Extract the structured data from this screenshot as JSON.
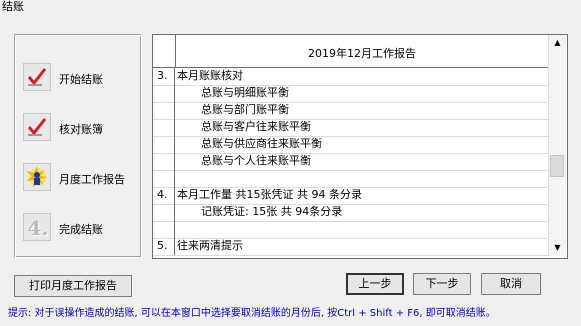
{
  "window": {
    "title": "结账"
  },
  "steps": [
    {
      "label": "开始结账",
      "icon": "check-mark-icon"
    },
    {
      "label": "核对账簿",
      "icon": "check-mark-icon"
    },
    {
      "label": "月度工作报告",
      "icon": "sparkle-person-icon"
    },
    {
      "label": "完成结账",
      "icon": "number-4-icon",
      "icon_text": "4."
    }
  ],
  "report": {
    "header": "2019年12月工作报告",
    "rows": [
      {
        "no": "3.",
        "text": "本月账账核对",
        "indent": false
      },
      {
        "no": "",
        "text": "总账与明细账平衡",
        "indent": true
      },
      {
        "no": "",
        "text": "总账与部门账平衡",
        "indent": true
      },
      {
        "no": "",
        "text": "总账与客户往来账平衡",
        "indent": true
      },
      {
        "no": "",
        "text": "总账与供应商往来账平衡",
        "indent": true
      },
      {
        "no": "",
        "text": "总账与个人往来账平衡",
        "indent": true
      },
      {
        "no": "",
        "text": "",
        "indent": false
      },
      {
        "no": "4.",
        "text": "本月工作量 共15张凭证 共 94 条分录",
        "indent": false
      },
      {
        "no": "",
        "text": "记账凭证: 15张   共   94条分录",
        "indent": true
      },
      {
        "no": "",
        "text": "",
        "indent": false
      },
      {
        "no": "5.",
        "text": "往来两清提示",
        "indent": false
      }
    ],
    "scroll_up": "▲",
    "scroll_down": "▼"
  },
  "buttons": {
    "print": "打印月度工作报告",
    "prev": "上一步",
    "next": "下一步",
    "cancel": "取消"
  },
  "hint": "提示: 对于误操作造成的结账, 可以在本窗口中选择要取消结账的月份后, 按Ctrl + Shift + F6, 即可取消结账。",
  "colors": {
    "hint": "#0000c0",
    "check_red": "#d02020"
  }
}
